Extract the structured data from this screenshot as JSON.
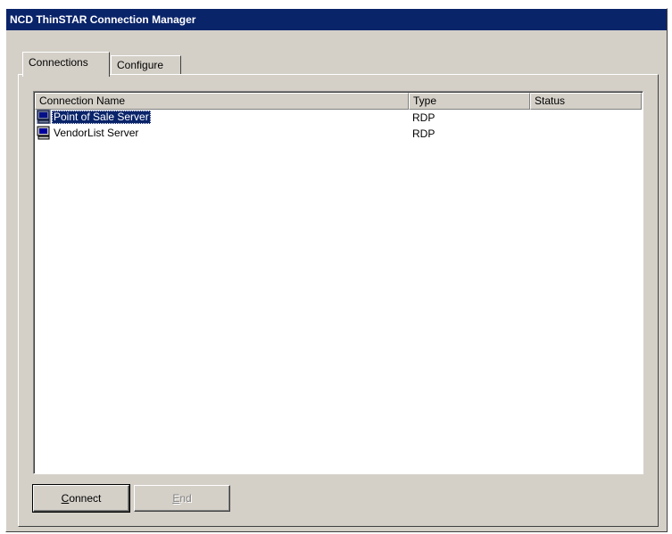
{
  "window": {
    "title": "NCD ThinSTAR Connection Manager"
  },
  "tabs": [
    {
      "label": "Connections",
      "active": true
    },
    {
      "label": "Configure",
      "active": false
    }
  ],
  "listview": {
    "columns": [
      "Connection Name",
      "Type",
      "Status"
    ],
    "rows": [
      {
        "name": "Point of Sale Server",
        "type": "RDP",
        "status": "",
        "selected": true,
        "icon": "computer-icon"
      },
      {
        "name": "VendorList Server",
        "type": "RDP",
        "status": "",
        "selected": false,
        "icon": "computer-icon"
      }
    ]
  },
  "buttons": {
    "connect_mnemonic": "C",
    "connect_rest": "onnect",
    "end_mnemonic": "E",
    "end_rest": "nd",
    "end_enabled": false
  },
  "colors": {
    "titlebar": "#0a246a",
    "selection": "#0a246a",
    "face": "#d4d0c8"
  }
}
